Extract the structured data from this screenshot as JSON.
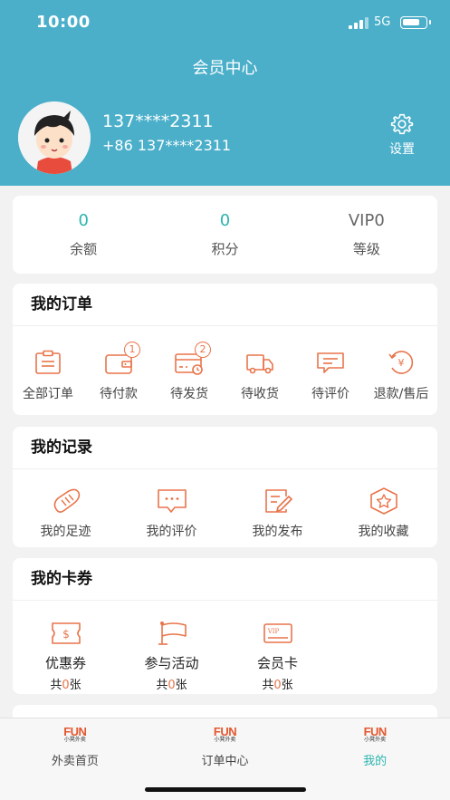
{
  "status_bar": {
    "time": "10:00",
    "network": "5G",
    "battery_level": 0.8
  },
  "header": {
    "title": "会员中心"
  },
  "profile": {
    "username": "137****2311",
    "phone": "+86 137****2311",
    "settings_label": "设置",
    "icons": {
      "avatar": "cartoon-boy-avatar",
      "settings": "gear-icon"
    }
  },
  "stats": [
    {
      "value": "0",
      "label": "余额"
    },
    {
      "value": "0",
      "label": "积分"
    },
    {
      "value": "VIP0",
      "label": "等级"
    }
  ],
  "orders": {
    "title": "我的订单",
    "items": [
      {
        "label": "全部订单",
        "icon": "clipboard-icon",
        "badge": ""
      },
      {
        "label": "待付款",
        "icon": "wallet-icon",
        "badge": "1"
      },
      {
        "label": "待发货",
        "icon": "card-clock-icon",
        "badge": "2"
      },
      {
        "label": "待收货",
        "icon": "truck-icon",
        "badge": ""
      },
      {
        "label": "待评价",
        "icon": "comment-icon",
        "badge": ""
      },
      {
        "label": "退款/售后",
        "icon": "refund-yen-icon",
        "badge": ""
      }
    ]
  },
  "records": {
    "title": "我的记录",
    "items": [
      {
        "label": "我的足迹",
        "icon": "footprint-icon"
      },
      {
        "label": "我的评价",
        "icon": "comment-bubble-icon"
      },
      {
        "label": "我的发布",
        "icon": "edit-note-icon"
      },
      {
        "label": "我的收藏",
        "icon": "star-hexagon-icon"
      }
    ]
  },
  "coupons": {
    "title": "我的卡券",
    "count_prefix": "共",
    "count_suffix": "张",
    "items": [
      {
        "label": "优惠券",
        "count": "0",
        "icon": "dollar-ticket-icon"
      },
      {
        "label": "参与活动",
        "count": "0",
        "icon": "flag-icon"
      },
      {
        "label": "会员卡",
        "count": "0",
        "icon": "vip-card-icon"
      }
    ]
  },
  "tabbar": {
    "logo_text": "FUN",
    "logo_subtext": "小凳外卖",
    "tabs": [
      {
        "label": "外卖首页",
        "active": false
      },
      {
        "label": "订单中心",
        "active": false
      },
      {
        "label": "我的",
        "active": true
      }
    ]
  },
  "colors": {
    "header": "#4bafca",
    "accent": "#2bb5ad",
    "icon": "#e8744a"
  }
}
